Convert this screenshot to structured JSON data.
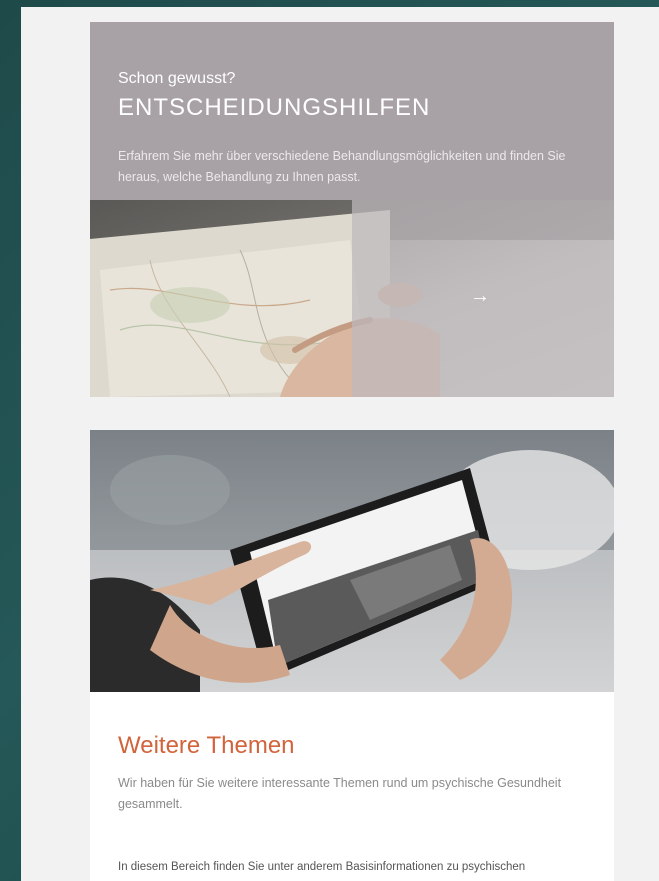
{
  "decision_card": {
    "eyebrow": "Schon gewusst?",
    "title": "ENTSCHEIDUNGSHILFEN",
    "description": "Erfahrem Sie mehr über verschiedene Behandlungsmöglichkeiten und finden Sie heraus, welche Behandlung zu Ihnen passt.",
    "arrow_icon": "arrow-right-icon",
    "arrow_glyph": "→"
  },
  "topics_card": {
    "title": "Weitere Themen",
    "intro": "Wir haben für Sie weitere interessante Themen rund um psychische Gesundheit gesammelt.",
    "body": "In diesem Bereich finden Sie unter anderem Basisinformationen zu psychischen"
  },
  "colors": {
    "accent": "#d2643c",
    "card_gray": "#a8a2a6",
    "page_bg": "#f2f2f2",
    "frame_bg": "#255858"
  }
}
